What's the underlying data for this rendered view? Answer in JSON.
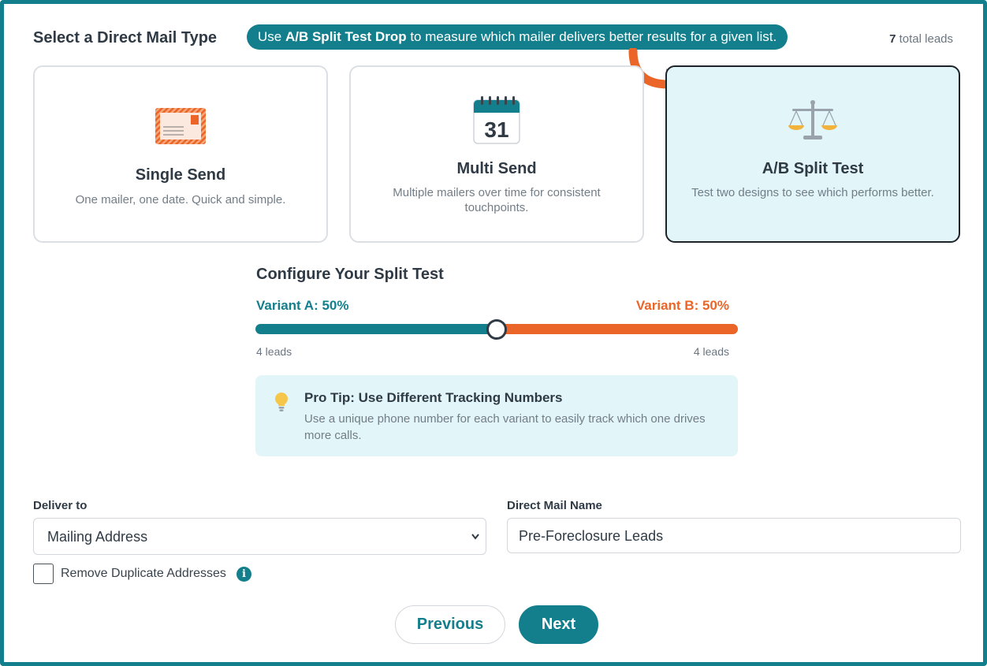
{
  "header": {
    "title": "Select a Direct Mail Type",
    "callout_prefix": "Use ",
    "callout_bold": "A/B Split Test Drop",
    "callout_suffix": " to measure which mailer delivers better results for a given list.",
    "total_leads_count": "7",
    "total_leads_label": " total leads"
  },
  "mail_types": [
    {
      "title": "Single Send",
      "description": "One mailer, one date. Quick and simple.",
      "icon": "envelope-icon",
      "selected": false
    },
    {
      "title": "Multi Send",
      "description": "Multiple mailers over time for consistent touchpoints.",
      "icon": "calendar-icon",
      "calendar_day": "31",
      "selected": false
    },
    {
      "title": "A/B Split Test",
      "description": "Test two designs to see which performs better.",
      "icon": "scale-icon",
      "selected": true
    }
  ],
  "split_test": {
    "title": "Configure Your Split Test",
    "variant_a_label": "Variant A: 50%",
    "variant_b_label": "Variant B: 50%",
    "variant_a_percent": 50,
    "variant_b_percent": 50,
    "variant_a_leads": "4 leads",
    "variant_b_leads": "4 leads"
  },
  "tip": {
    "icon": "lightbulb-icon",
    "title": "Pro Tip: Use Different Tracking Numbers",
    "body": "Use a unique phone number for each variant to easily track which one drives more calls."
  },
  "form": {
    "deliver_to_label": "Deliver to",
    "deliver_to_value": "Mailing Address",
    "name_label": "Direct Mail Name",
    "name_value": "Pre-Foreclosure Leads",
    "remove_duplicates_label": "Remove Duplicate Addresses",
    "remove_duplicates_checked": false,
    "info_glyph": "i"
  },
  "actions": {
    "previous_label": "Previous",
    "next_label": "Next"
  },
  "colors": {
    "primary": "#147f8c",
    "accent": "#ea6527",
    "selected_bg": "#e2f5f8"
  }
}
